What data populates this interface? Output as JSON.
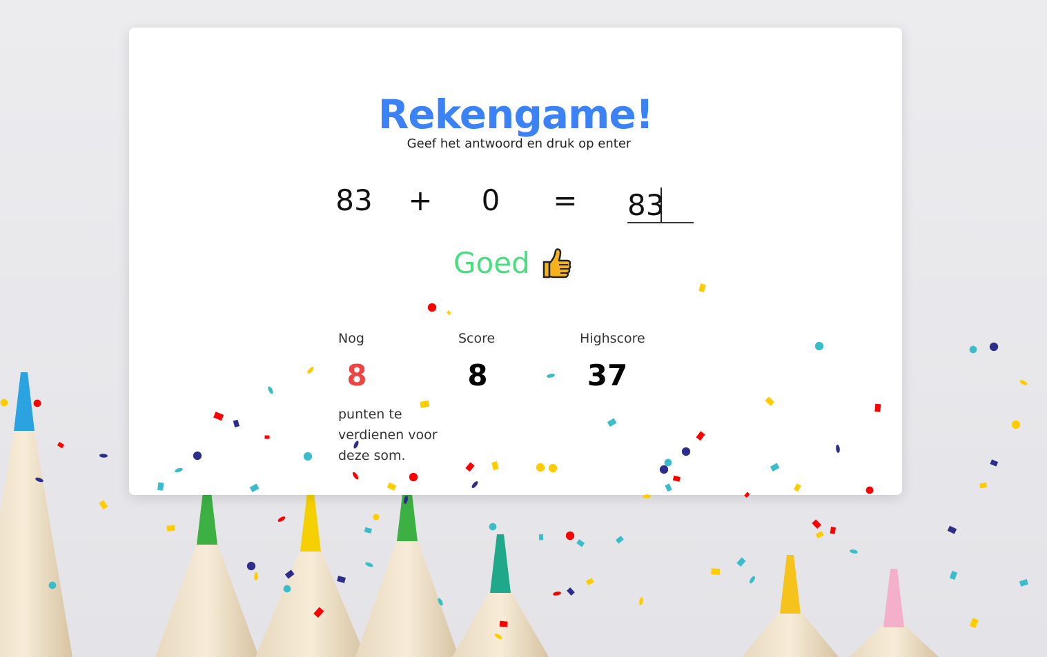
{
  "colors": {
    "title": "#3b82f6",
    "good": "#4ade80",
    "remaining": "#ef4444",
    "text": "#111111"
  },
  "game": {
    "title": "Rekengame!",
    "instruction": "Geef het antwoord en druk op enter",
    "sum": {
      "left": "83",
      "operator": "+",
      "right": "0",
      "equals": "=",
      "answer": "83"
    },
    "feedback": {
      "text": "Goed",
      "icon": "thumbs-up-icon"
    }
  },
  "stats": {
    "remaining_label": "Nog",
    "remaining_value": "8",
    "remaining_note": "punten te verdienen voor deze som.",
    "score_label": "Score",
    "score_value": "8",
    "highscore_label": "Highscore",
    "highscore_value": "37"
  },
  "background": {
    "image": "colored-pencils-photo",
    "pencil_colors": [
      "#2aa3e0",
      "#3cb043",
      "#f5d000",
      "#1fa88a",
      "#f6c21c",
      "#f3b0c8"
    ]
  },
  "confetti_colors": [
    "#ff0000",
    "#2d2d8a",
    "#3bbdc9",
    "#ffcc00"
  ]
}
